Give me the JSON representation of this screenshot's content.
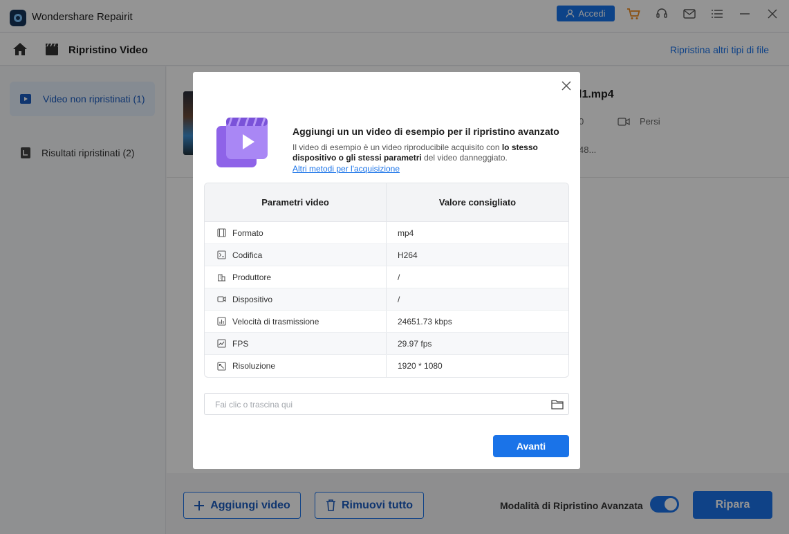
{
  "app": {
    "title": "Wondershare Repairit",
    "login_label": "Accedi"
  },
  "nav": {
    "title": "Ripristino Video",
    "other_types_link": "Ripristina altri tipi di file"
  },
  "sidebar": {
    "items": [
      {
        "label": "Video non ripristinati (1)",
        "active": true
      },
      {
        "label": "Risultati ripristinati (2)",
        "active": false
      }
    ]
  },
  "file": {
    "name_partial": "l1.mp4",
    "meta_partial": "0",
    "device_label": "Persi",
    "size_partial": "48..."
  },
  "bottom": {
    "add_video": "Aggiungi video",
    "remove_all": "Rimuovi tutto",
    "advanced_mode": "Modalità di Ripristino Avanzata",
    "advanced_mode_on": true,
    "repair": "Ripara"
  },
  "modal": {
    "title": "Aggiungi un un video di esempio per il ripristino avanzato",
    "desc_part1": "Il video di esempio è un video riproducibile acquisito con ",
    "desc_bold": "lo stesso dispositivo o gli stessi parametri",
    "desc_part2": " del video danneggiato.",
    "link": "Altri metodi per l'acquisizione",
    "table": {
      "header_param": "Parametri video",
      "header_value": "Valore consigliato",
      "rows": [
        {
          "icon": "format-icon",
          "param": "Formato",
          "value": "mp4"
        },
        {
          "icon": "codec-icon",
          "param": "Codifica",
          "value": "H264"
        },
        {
          "icon": "producer-icon",
          "param": "Produttore",
          "value": "/"
        },
        {
          "icon": "device-icon",
          "param": "Dispositivo",
          "value": "/"
        },
        {
          "icon": "bitrate-icon",
          "param": "Velocità di trasmissione",
          "value": "24651.73 kbps"
        },
        {
          "icon": "fps-icon",
          "param": "FPS",
          "value": "29.97 fps"
        },
        {
          "icon": "resolution-icon",
          "param": "Risoluzione",
          "value": "1920 * 1080"
        }
      ]
    },
    "input_placeholder": "Fai clic o trascina qui",
    "next_button": "Avanti"
  },
  "colors": {
    "accent": "#1a73e8",
    "overlay": "rgba(0,0,0,0.42)"
  }
}
